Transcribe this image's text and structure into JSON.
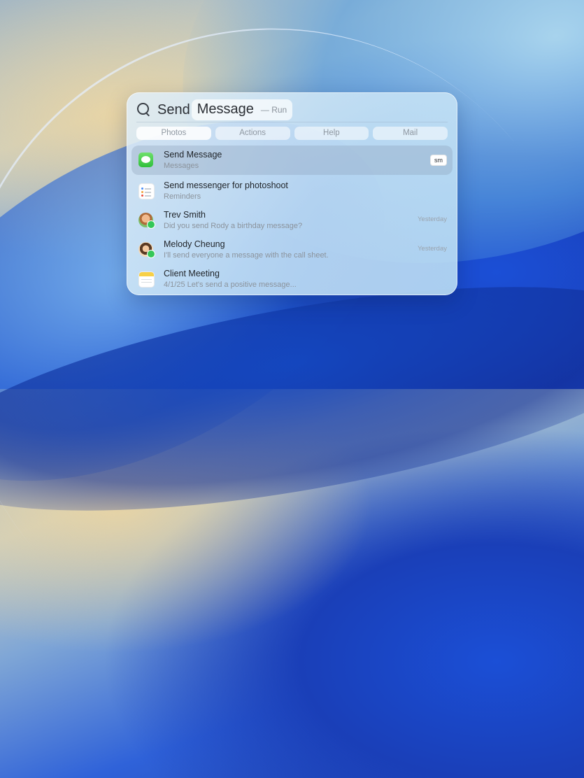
{
  "search": {
    "typed": "Send",
    "completion": "Message",
    "hint": "— Run"
  },
  "tabs": [
    "Photos",
    "Actions",
    "Help",
    "Mail"
  ],
  "results": [
    {
      "title": "Send Message",
      "subtitle": "Messages",
      "shortcut": "sm",
      "icon": "messages-icon"
    },
    {
      "title": "Send messenger for photoshoot",
      "subtitle": "Reminders",
      "icon": "reminders-icon"
    },
    {
      "title": "Trev Smith",
      "subtitle": "Did you send Rody a birthday message?",
      "meta": "Yesterday",
      "icon": "contact-avatar-icon"
    },
    {
      "title": "Melody Cheung",
      "subtitle": "I'll send everyone a message with the call sheet.",
      "meta": "Yesterday",
      "icon": "contact-avatar-icon"
    },
    {
      "title": "Client Meeting",
      "subtitle": "4/1/25 Let's send a positive message...",
      "icon": "notes-icon"
    }
  ],
  "colors": {
    "selection": "#8ca0b9",
    "messages_green": "#34c759",
    "notes_yellow": "#f7d046"
  }
}
